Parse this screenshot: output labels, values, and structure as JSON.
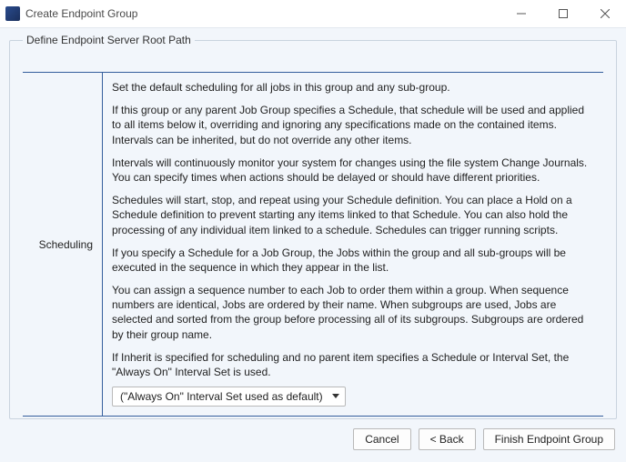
{
  "window": {
    "title": "Create Endpoint Group"
  },
  "groupbox": {
    "legend": "Define Endpoint Server Root Path"
  },
  "scheduling": {
    "label": "Scheduling",
    "paragraphs": [
      "Set the default scheduling for all jobs in this group and any sub-group.",
      "If this group or any parent Job Group specifies a Schedule, that schedule will be used and applied to all items below it, overriding and ignoring any specifications made on the contained items. Intervals can be inherited, but do not override any other items.",
      "Intervals will continuously monitor your system for changes using the file system Change Journals. You can specify times when actions should be delayed or should have different priorities.",
      "Schedules will start, stop, and repeat using your Schedule definition. You can place a Hold on a Schedule definition to prevent starting any items linked to that Schedule. You can also hold the processing of any individual item linked to a schedule. Schedules can trigger running scripts.",
      "If you specify a Schedule for a Job Group, the Jobs within the group and all sub-groups will be executed in the sequence in which they appear in the list.",
      "You can assign a sequence number to each Job to order them within a group. When sequence numbers are identical, Jobs are ordered by their name. When subgroups are used, Jobs are selected and sorted from the group before processing all of its subgroups. Subgroups are ordered by their group name.",
      "If Inherit is specified for scheduling and no parent item specifies a Schedule or Interval Set, the \"Always On\" Interval Set is used."
    ],
    "combo_value": "(\"Always On\" Interval Set used as default)"
  },
  "footer": {
    "cancel": "Cancel",
    "back": "< Back",
    "finish": "Finish Endpoint Group"
  }
}
